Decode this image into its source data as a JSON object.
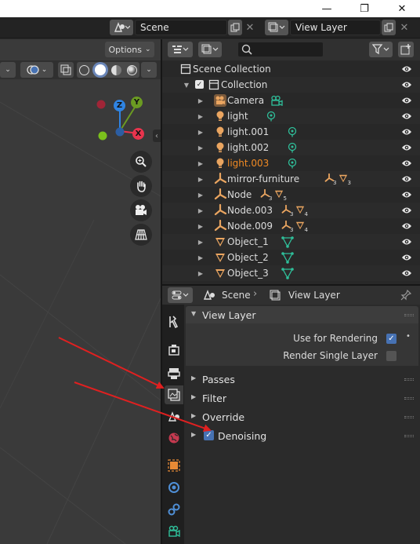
{
  "window": {
    "minimize_glyph": "—",
    "maximize_glyph": "❐",
    "close_glyph": "✕"
  },
  "topbar": {
    "scene_field": "Scene",
    "view_layer_field": "View Layer"
  },
  "viewport": {
    "options_label": "Options",
    "gizmo_labels": {
      "z": "Z",
      "y": "Y",
      "x": "X"
    },
    "gizmo_colors": {
      "z": "#2f84e3",
      "y": "#6b9b22",
      "x": "#e8344d",
      "neg_y": "#7bc01c",
      "neg_x": "#a02537",
      "neg_z": "#2c5ea3"
    }
  },
  "outliner": {
    "search_placeholder": "",
    "rows": [
      {
        "label": "Scene Collection",
        "icon": "scene-collection-icon"
      },
      {
        "label": "Collection",
        "icon": "collection-icon"
      },
      {
        "label": "Camera",
        "icon": "camera-object-icon"
      },
      {
        "label": "light",
        "icon": "light-object-icon"
      },
      {
        "label": "light.001",
        "icon": "light-object-icon"
      },
      {
        "label": "light.002",
        "icon": "light-object-icon"
      },
      {
        "label": "light.003",
        "icon": "light-object-icon",
        "highlight": "#f08a24"
      },
      {
        "label": "mirror-furniture",
        "icon": "empty-object-icon",
        "counts": [
          "3",
          "3"
        ]
      },
      {
        "label": "Node",
        "icon": "empty-object-icon",
        "counts": [
          "3",
          "5"
        ]
      },
      {
        "label": "Node.003",
        "icon": "empty-object-icon",
        "counts": [
          "3",
          "4"
        ]
      },
      {
        "label": "Node.009",
        "icon": "empty-object-icon",
        "counts": [
          "3",
          "4"
        ]
      },
      {
        "label": "Object_1",
        "icon": "mesh-object-icon"
      },
      {
        "label": "Object_2",
        "icon": "mesh-object-icon"
      },
      {
        "label": "Object_3",
        "icon": "mesh-object-icon"
      }
    ]
  },
  "properties": {
    "header": {
      "scene_label": "Scene",
      "view_layer_label": "View Layer"
    },
    "view_layer_panel": {
      "title": "View Layer",
      "use_for_rendering_label": "Use for Rendering",
      "use_for_rendering": true,
      "render_single_layer_label": "Render Single Layer",
      "render_single_layer": false
    },
    "panels": [
      {
        "title": "Passes"
      },
      {
        "title": "Filter"
      },
      {
        "title": "Override"
      },
      {
        "title": "Denoising",
        "checkbox": true
      }
    ]
  },
  "annotation": {
    "arrow_color": "#e02020"
  }
}
